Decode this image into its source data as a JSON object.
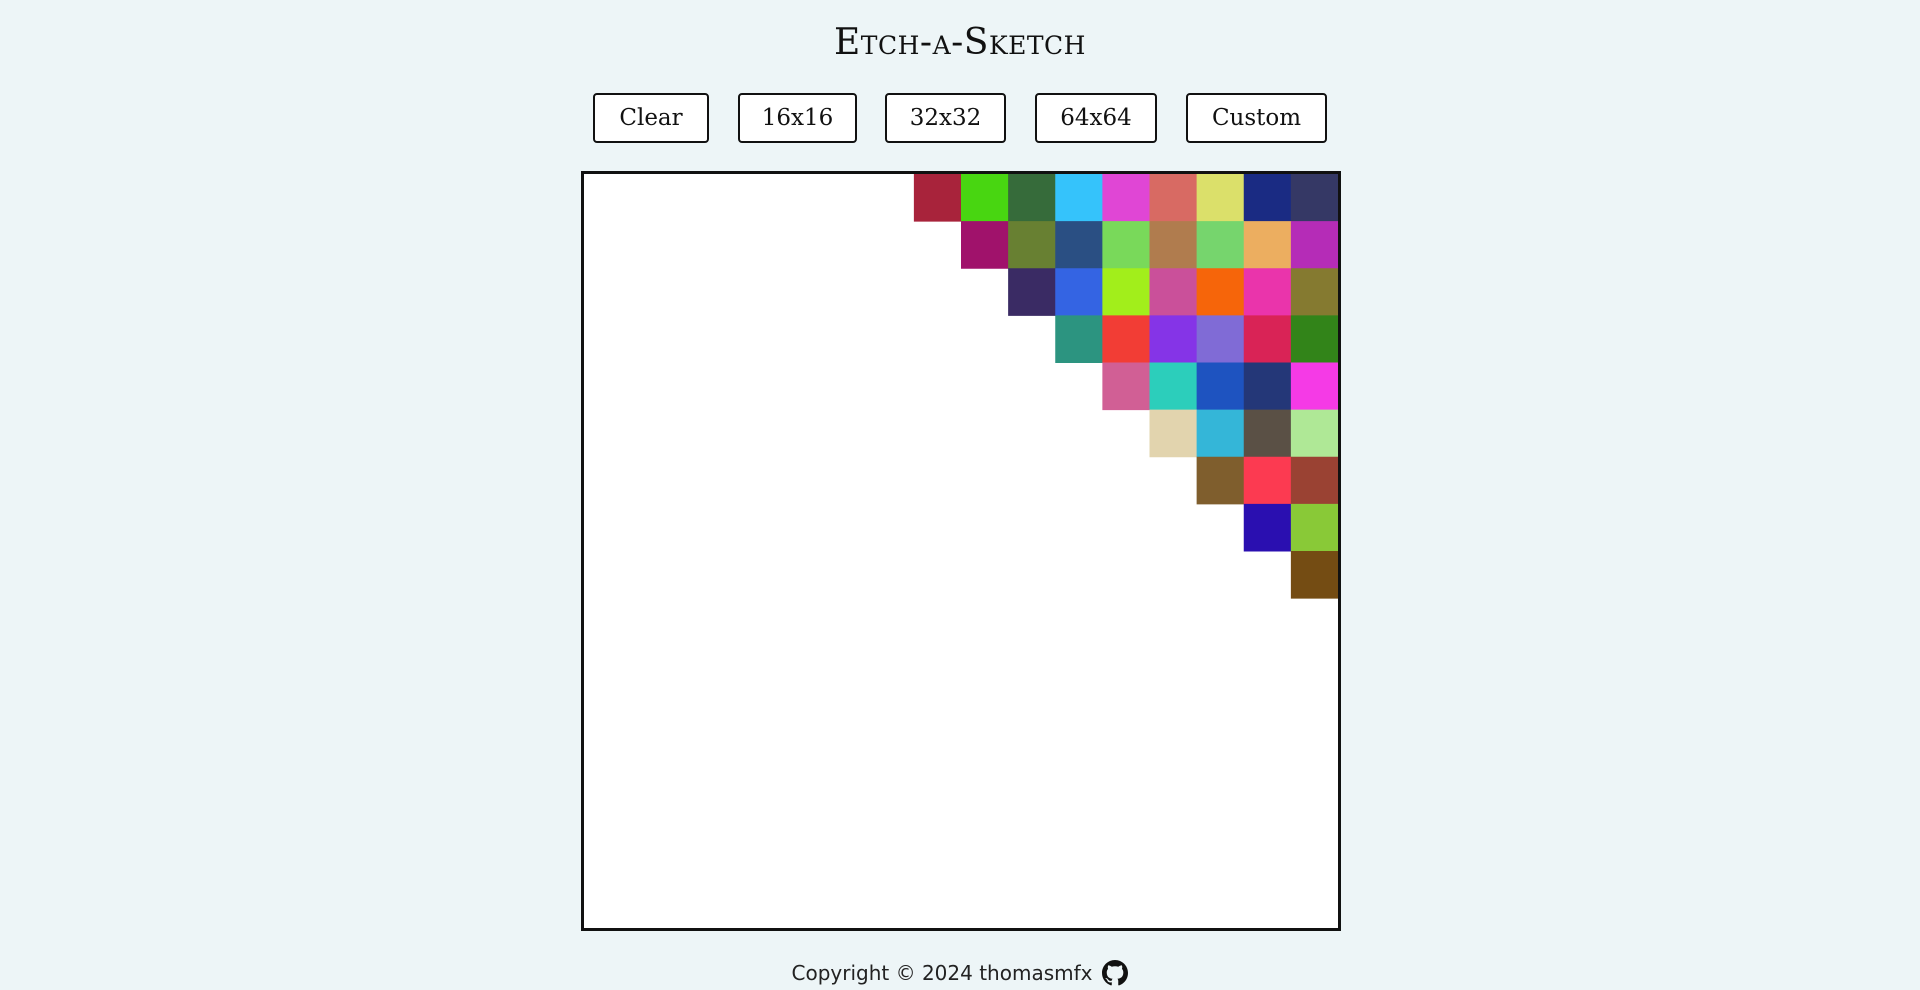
{
  "header": {
    "title": "Etch-a-Sketch"
  },
  "toolbar": {
    "clear_label": "Clear",
    "grid16_label": "16x16",
    "grid32_label": "32x32",
    "grid64_label": "64x64",
    "custom_label": "Custom"
  },
  "grid": {
    "size": 16,
    "colored_cells": [
      {
        "row": 0,
        "col": 7,
        "color": "#a8233b"
      },
      {
        "row": 0,
        "col": 8,
        "color": "#48d611"
      },
      {
        "row": 0,
        "col": 9,
        "color": "#366b3a"
      },
      {
        "row": 0,
        "col": 10,
        "color": "#35c3fb"
      },
      {
        "row": 0,
        "col": 11,
        "color": "#e046d5"
      },
      {
        "row": 0,
        "col": 12,
        "color": "#d86a63"
      },
      {
        "row": 0,
        "col": 13,
        "color": "#dbe06a"
      },
      {
        "row": 0,
        "col": 14,
        "color": "#1a2b83"
      },
      {
        "row": 0,
        "col": 15,
        "color": "#353865"
      },
      {
        "row": 1,
        "col": 8,
        "color": "#a0126b"
      },
      {
        "row": 1,
        "col": 9,
        "color": "#688032"
      },
      {
        "row": 1,
        "col": 10,
        "color": "#2a4f83"
      },
      {
        "row": 1,
        "col": 11,
        "color": "#79d95a"
      },
      {
        "row": 1,
        "col": 12,
        "color": "#b07c4e"
      },
      {
        "row": 1,
        "col": 13,
        "color": "#76d56d"
      },
      {
        "row": 1,
        "col": 14,
        "color": "#ecae60"
      },
      {
        "row": 1,
        "col": 15,
        "color": "#b52cb7"
      },
      {
        "row": 2,
        "col": 9,
        "color": "#3a2b64"
      },
      {
        "row": 2,
        "col": 10,
        "color": "#3464e3"
      },
      {
        "row": 2,
        "col": 11,
        "color": "#a2ee1b"
      },
      {
        "row": 2,
        "col": 12,
        "color": "#ca509a"
      },
      {
        "row": 2,
        "col": 13,
        "color": "#f6650a"
      },
      {
        "row": 2,
        "col": 14,
        "color": "#ea34ab"
      },
      {
        "row": 2,
        "col": 15,
        "color": "#857a30"
      },
      {
        "row": 3,
        "col": 10,
        "color": "#2c9480"
      },
      {
        "row": 3,
        "col": 11,
        "color": "#f23d35"
      },
      {
        "row": 3,
        "col": 12,
        "color": "#8534e7"
      },
      {
        "row": 3,
        "col": 13,
        "color": "#806bd6"
      },
      {
        "row": 3,
        "col": 14,
        "color": "#d92356"
      },
      {
        "row": 3,
        "col": 15,
        "color": "#328419"
      },
      {
        "row": 4,
        "col": 11,
        "color": "#d15f95"
      },
      {
        "row": 4,
        "col": 12,
        "color": "#2ccebb"
      },
      {
        "row": 4,
        "col": 13,
        "color": "#1e53c0"
      },
      {
        "row": 4,
        "col": 14,
        "color": "#243778"
      },
      {
        "row": 4,
        "col": 15,
        "color": "#f53ae6"
      },
      {
        "row": 5,
        "col": 12,
        "color": "#e2d4ae"
      },
      {
        "row": 5,
        "col": 13,
        "color": "#34b6d8"
      },
      {
        "row": 5,
        "col": 14,
        "color": "#5a5045"
      },
      {
        "row": 5,
        "col": 15,
        "color": "#afe896"
      },
      {
        "row": 6,
        "col": 13,
        "color": "#7f5e2d"
      },
      {
        "row": 6,
        "col": 14,
        "color": "#fc3a51"
      },
      {
        "row": 6,
        "col": 15,
        "color": "#9a4233"
      },
      {
        "row": 7,
        "col": 14,
        "color": "#2a0fb0"
      },
      {
        "row": 7,
        "col": 15,
        "color": "#89c937"
      },
      {
        "row": 8,
        "col": 15,
        "color": "#744c13"
      }
    ]
  },
  "footer": {
    "copyright": "Copyright © 2024 thomasmfx",
    "github_icon": "github-icon"
  }
}
